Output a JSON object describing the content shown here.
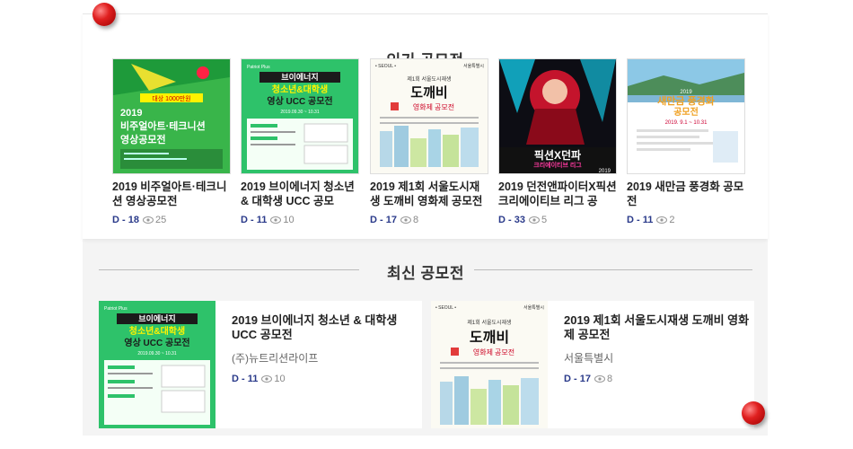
{
  "popular": {
    "title": "인기 공모전",
    "cards": [
      {
        "title": "2019 비주얼아트·테크니션 영상공모전",
        "dday": "D - 18",
        "views": "25"
      },
      {
        "title": "2019 브이에너지 청소년 & 대학생 UCC 공모",
        "dday": "D - 11",
        "views": "10"
      },
      {
        "title": "2019 제1회 서울도시재생 도깨비 영화제 공모전",
        "dday": "D - 17",
        "views": "8"
      },
      {
        "title": "2019 던전앤파이터X픽션 크리에이티브 리그 공",
        "dday": "D - 33",
        "views": "5"
      },
      {
        "title": "2019 새만금 풍경화 공모전",
        "dday": "D - 11",
        "views": "2"
      }
    ]
  },
  "posters": {
    "p1": {
      "year": "2019",
      "line1": "비주얼아트·테크니션",
      "line2": "영상공모전",
      "badge": "대상 1000만원"
    },
    "p2": {
      "brand": "Patriot Plus",
      "line1": "브이에너지",
      "line2": "청소년&대학생",
      "line3": "영상 UCC 공모전",
      "period": "2019.09.30 ~ 10.31"
    },
    "p3": {
      "brand": "• SEOUL •",
      "brand2": "서울특별시",
      "sub": "제1회 서울도시재생",
      "main": "도깨비",
      "tail": "영화제 공모전"
    },
    "p4": {
      "main": "픽션X던파",
      "sub": "크리에이티브 리그",
      "year": "2019"
    },
    "p5": {
      "year": "2019",
      "main": "새만금 풍경화",
      "sub": "공모전",
      "date": "2019. 9.1 ~ 10.31"
    }
  },
  "latest": {
    "title": "최신 공모전",
    "items": [
      {
        "title": "2019 브이에너지 청소년 & 대학생 UCC 공모전",
        "org": "(주)뉴트리션라이프",
        "dday": "D - 11",
        "views": "10"
      },
      {
        "title": "2019 제1회 서울도시재생 도깨비 영화제 공모전",
        "org": "서울특별시",
        "dday": "D - 17",
        "views": "8"
      }
    ]
  }
}
